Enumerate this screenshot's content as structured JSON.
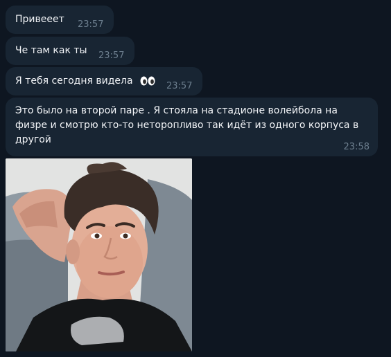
{
  "messages": [
    {
      "text": "Привееет",
      "time": "23:57"
    },
    {
      "text": "Че там как ты",
      "time": "23:57"
    },
    {
      "text": "Я тебя сегодня видела",
      "emoji": "eyes-icon",
      "time": "23:57"
    },
    {
      "text": "Это было на второй паре . Я стояла на стадионе волейбола на физре и смотрю кто-то неторопливо так идёт из одного корпуса в другой",
      "time": "23:58"
    }
  ],
  "colors": {
    "background": "#0e1621",
    "bubble": "#182533",
    "text": "#f2f4f7",
    "time": "#6d7f8f"
  }
}
